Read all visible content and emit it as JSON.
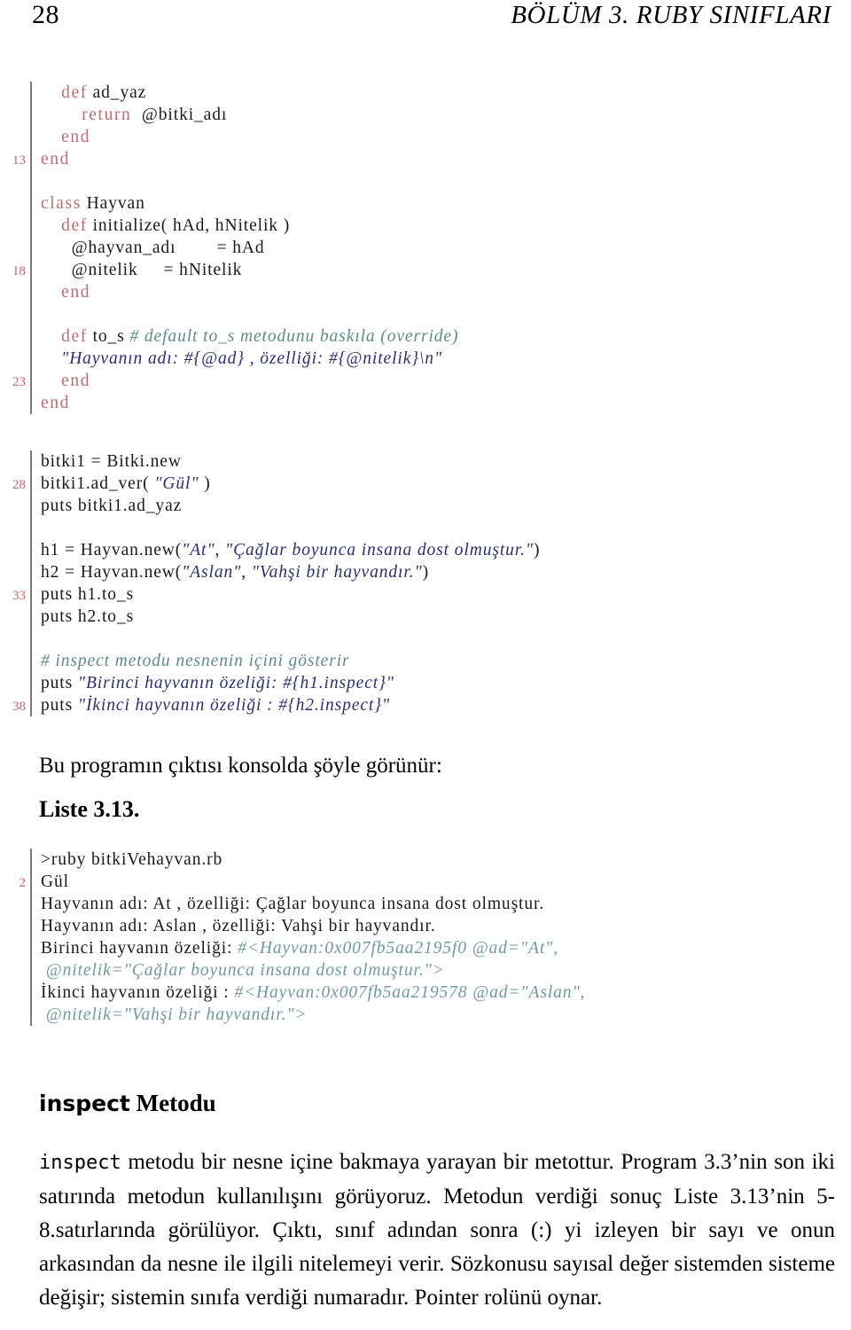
{
  "header": {
    "page_number": "28",
    "chapter_title": "BÖLÜM 3.  RUBY SINIFLARI"
  },
  "colors": {
    "keyword": "#bd6b72",
    "string": "#2a2f73",
    "comment": "#5d8b8b",
    "line_number": "#c9636b",
    "rule": "#7b7b7b",
    "output_hex": "#6f9a9a",
    "text": "#1a1a1a"
  },
  "code_block_1": {
    "lines": [
      {
        "num": "",
        "segments": [
          {
            "t": "    ",
            "c": "plain"
          },
          {
            "t": "def",
            "c": "kw"
          },
          {
            "t": " ad_yaz",
            "c": "plain"
          }
        ]
      },
      {
        "num": "",
        "segments": [
          {
            "t": "        ",
            "c": "plain"
          },
          {
            "t": "return",
            "c": "kw"
          },
          {
            "t": "  @bitki_adı",
            "c": "plain"
          }
        ]
      },
      {
        "num": "",
        "segments": [
          {
            "t": "    ",
            "c": "plain"
          },
          {
            "t": "end",
            "c": "kw"
          }
        ]
      },
      {
        "num": "13",
        "segments": [
          {
            "t": "",
            "c": "plain"
          },
          {
            "t": "end",
            "c": "kw"
          }
        ]
      },
      {
        "num": "",
        "segments": [
          {
            "t": "",
            "c": "plain"
          }
        ]
      },
      {
        "num": "",
        "segments": [
          {
            "t": "",
            "c": "plain"
          },
          {
            "t": "class",
            "c": "kw"
          },
          {
            "t": " Hayvan",
            "c": "plain"
          }
        ]
      },
      {
        "num": "",
        "segments": [
          {
            "t": "    ",
            "c": "plain"
          },
          {
            "t": "def",
            "c": "kw"
          },
          {
            "t": " initialize( hAd, hNitelik )",
            "c": "plain"
          }
        ]
      },
      {
        "num": "",
        "segments": [
          {
            "t": "      @hayvan_adı        = hAd",
            "c": "plain"
          }
        ]
      },
      {
        "num": "18",
        "segments": [
          {
            "t": "      @nitelik     = hNitelik",
            "c": "plain"
          }
        ]
      },
      {
        "num": "",
        "segments": [
          {
            "t": "    ",
            "c": "plain"
          },
          {
            "t": "end",
            "c": "kw"
          }
        ]
      },
      {
        "num": "",
        "segments": [
          {
            "t": "",
            "c": "plain"
          }
        ]
      },
      {
        "num": "",
        "segments": [
          {
            "t": "    ",
            "c": "plain"
          },
          {
            "t": "def",
            "c": "kw"
          },
          {
            "t": " to_s ",
            "c": "plain"
          },
          {
            "t": "# default to_s metodunu baskıla (override)",
            "c": "cmt"
          }
        ]
      },
      {
        "num": "",
        "segments": [
          {
            "t": "    ",
            "c": "plain"
          },
          {
            "t": "\"Hayvanın adı: #{@ad} , özelliği: #{@nitelik}\\n\"",
            "c": "str"
          }
        ]
      },
      {
        "num": "23",
        "segments": [
          {
            "t": "    ",
            "c": "plain"
          },
          {
            "t": "end",
            "c": "kw"
          }
        ]
      },
      {
        "num": "",
        "segments": [
          {
            "t": "",
            "c": "plain"
          },
          {
            "t": "end",
            "c": "kw"
          }
        ]
      }
    ]
  },
  "code_block_2": {
    "lines": [
      {
        "num": "",
        "segments": [
          {
            "t": "bitki1 = Bitki.new",
            "c": "plain"
          }
        ]
      },
      {
        "num": "28",
        "segments": [
          {
            "t": "bitki1.ad_ver( ",
            "c": "plain"
          },
          {
            "t": "\"Gül\"",
            "c": "str"
          },
          {
            "t": " )",
            "c": "plain"
          }
        ]
      },
      {
        "num": "",
        "segments": [
          {
            "t": "puts bitki1.ad_yaz",
            "c": "plain"
          }
        ]
      },
      {
        "num": "",
        "segments": [
          {
            "t": "",
            "c": "plain"
          }
        ]
      },
      {
        "num": "",
        "segments": [
          {
            "t": "h1 = Hayvan.new(",
            "c": "plain"
          },
          {
            "t": "\"At\"",
            "c": "str"
          },
          {
            "t": ", ",
            "c": "plain"
          },
          {
            "t": "\"Çağlar boyunca insana dost olmuştur.\"",
            "c": "str"
          },
          {
            "t": ")",
            "c": "plain"
          }
        ]
      },
      {
        "num": "",
        "segments": [
          {
            "t": "h2 = Hayvan.new(",
            "c": "plain"
          },
          {
            "t": "\"Aslan\"",
            "c": "str"
          },
          {
            "t": ", ",
            "c": "plain"
          },
          {
            "t": "\"Vahşi bir hayvandır.\"",
            "c": "str"
          },
          {
            "t": ")",
            "c": "plain"
          }
        ]
      },
      {
        "num": "33",
        "segments": [
          {
            "t": "puts h1.to_s",
            "c": "plain"
          }
        ]
      },
      {
        "num": "",
        "segments": [
          {
            "t": "puts h2.to_s",
            "c": "plain"
          }
        ]
      },
      {
        "num": "",
        "segments": [
          {
            "t": "",
            "c": "plain"
          }
        ]
      },
      {
        "num": "",
        "segments": [
          {
            "t": "# inspect metodu nesnenin içini gösterir",
            "c": "cmt"
          }
        ]
      },
      {
        "num": "",
        "segments": [
          {
            "t": "puts ",
            "c": "plain"
          },
          {
            "t": "\"Birinci hayvanın özeliği: #{h1.inspect}\"",
            "c": "str"
          }
        ]
      },
      {
        "num": "38",
        "segments": [
          {
            "t": "puts ",
            "c": "plain"
          },
          {
            "t": "\"İkinci hayvanın özeliği : #{h2.inspect}\"",
            "c": "str"
          }
        ]
      }
    ]
  },
  "paragraph_1": "Bu programın çıktısı konsolda şöyle görünür:",
  "listing_label": "Liste 3.13.",
  "output_block": {
    "lines": [
      {
        "num": "",
        "segments": [
          {
            "t": ">ruby bitkiVehayvan.rb",
            "c": "plain"
          }
        ]
      },
      {
        "num": "2",
        "segments": [
          {
            "t": "Gül",
            "c": "plain"
          }
        ]
      },
      {
        "num": "",
        "segments": [
          {
            "t": "Hayvanın adı: At , özelliği: Çağlar boyunca insana dost olmuştur.",
            "c": "plain"
          }
        ]
      },
      {
        "num": "",
        "segments": [
          {
            "t": "Hayvanın adı: Aslan , özelliği: Vahşi bir hayvandır.",
            "c": "plain"
          }
        ]
      },
      {
        "num": "",
        "segments": [
          {
            "t": "Birinci hayvanın özeliği: ",
            "c": "plain"
          },
          {
            "t": "#<Hayvan:0x007fb5aa2195f0 @ad=\"At\",",
            "c": "out-hex"
          }
        ]
      },
      {
        "num": "",
        "segments": [
          {
            "t": " ",
            "c": "plain"
          },
          {
            "t": "@nitelik=\"Çağlar boyunca insana dost olmuştur.\">",
            "c": "out-hex"
          }
        ]
      },
      {
        "num": "",
        "segments": [
          {
            "t": "İkinci hayvanın özeliği : ",
            "c": "plain"
          },
          {
            "t": "#<Hayvan:0x007fb5aa219578 @ad=\"Aslan\",",
            "c": "out-hex"
          }
        ]
      },
      {
        "num": "",
        "segments": [
          {
            "t": " ",
            "c": "plain"
          },
          {
            "t": "@nitelik=\"Vahşi bir hayvandır.\">",
            "c": "out-hex"
          }
        ]
      }
    ]
  },
  "section_heading": {
    "mono_part": "inspect",
    "rest_part": " Metodu"
  },
  "paragraph_2": {
    "mono_lead": "inspect",
    "body": " metodu bir nesne içine bakmaya yarayan bir metottur. Program 3.3’nin son iki satırında metodun kullanılışını görüyoruz. Metodun verdiği sonuç Liste 3.13’nin 5-8.satırlarında görülüyor. Çıktı, sınıf adından sonra (:) yi izleyen bir sayı ve onun arkasından da nesne ile ilgili nitelemeyi verir. Sözkonusu sayısal değer sistemden sisteme değişir; sistemin sınıfa verdiği numaradır. Pointer rolünü oynar."
  }
}
